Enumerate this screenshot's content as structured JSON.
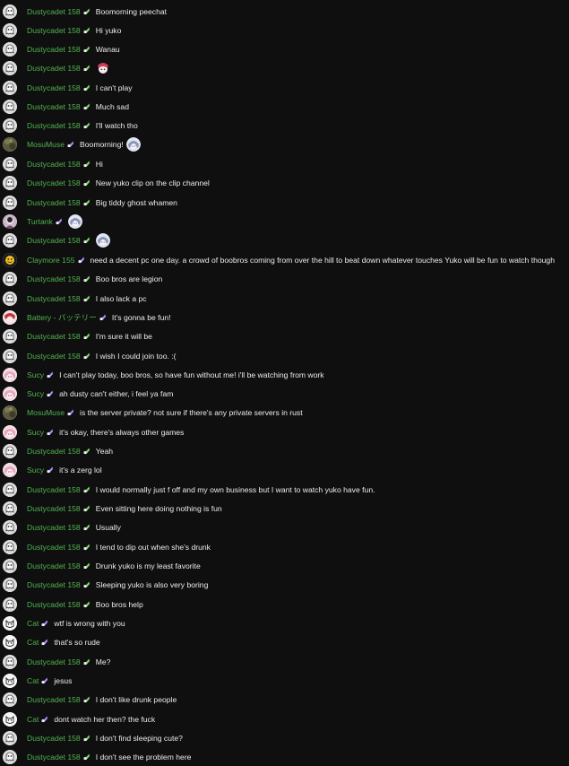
{
  "colors": {
    "username": "#51b34f",
    "text": "#ececec",
    "background": "#0f0f0f",
    "badge_green": "#7bdc6a",
    "badge_purple": "#b48cff"
  },
  "messages": [
    {
      "author": "Dustycadet 158",
      "text": "Boomorning peechat",
      "avatar": "ghost",
      "badge": "green"
    },
    {
      "author": "Dustycadet 158",
      "text": "Hi yuko",
      "avatar": "ghost",
      "badge": "green"
    },
    {
      "author": "Dustycadet 158",
      "text": "Wanau",
      "avatar": "ghost",
      "badge": "green"
    },
    {
      "author": "Dustycadet 158",
      "text": "",
      "avatar": "ghost",
      "badge": "green",
      "emote": "emote-anime-girl-icon"
    },
    {
      "author": "Dustycadet 158",
      "text": "I can't play",
      "avatar": "ghost",
      "badge": "green"
    },
    {
      "author": "Dustycadet 158",
      "text": "Much sad",
      "avatar": "ghost",
      "badge": "green"
    },
    {
      "author": "Dustycadet 158",
      "text": "I'll watch tho",
      "avatar": "ghost",
      "badge": "green"
    },
    {
      "author": "MosuMuse",
      "text": "Boomorning!",
      "avatar": "camo",
      "badge": "purple",
      "emote": "emote-yuko-icon"
    },
    {
      "author": "Dustycadet 158",
      "text": "Hi",
      "avatar": "ghost",
      "badge": "green"
    },
    {
      "author": "Dustycadet 158",
      "text": "New yuko clip on the clip channel",
      "avatar": "ghost",
      "badge": "green"
    },
    {
      "author": "Dustycadet 158",
      "text": "Big tiddy ghost whamen",
      "avatar": "ghost",
      "badge": "green"
    },
    {
      "author": "Turtank",
      "text": "",
      "avatar": "turtank",
      "badge": "purple",
      "emote": "emote-yuko-icon"
    },
    {
      "author": "Dustycadet 158",
      "text": "",
      "avatar": "ghost",
      "badge": "green",
      "emote": "emote-yuko-icon"
    },
    {
      "author": "Claymore 155",
      "text": "need a decent pc one day. a crowd of boobros coming from over the hill to beat down whatever touches Yuko will be fun to watch though",
      "avatar": "claymore",
      "badge": "purple"
    },
    {
      "author": "Dustycadet 158",
      "text": "Boo bros are legion",
      "avatar": "ghost",
      "badge": "green"
    },
    {
      "author": "Dustycadet 158",
      "text": "I also lack a pc",
      "avatar": "ghost",
      "badge": "green"
    },
    {
      "author": "Battery - バッテリー",
      "text": "It's gonna be fun!",
      "avatar": "battery",
      "badge": "purple"
    },
    {
      "author": "Dustycadet 158",
      "text": "I'm sure it will be",
      "avatar": "ghost",
      "badge": "green"
    },
    {
      "author": "Dustycadet 158",
      "text": "I wish I could join too. :(",
      "avatar": "ghost",
      "badge": "green"
    },
    {
      "author": "Sucy",
      "text": "I can't play today, boo bros, so have fun without me! i'll be watching from work",
      "avatar": "sucy",
      "badge": "purple"
    },
    {
      "author": "Sucy",
      "text": "ah dusty can't either, i feel ya fam",
      "avatar": "sucy",
      "badge": "purple"
    },
    {
      "author": "MosuMuse",
      "text": "is the server private? not sure if there's any private servers in rust",
      "avatar": "camo",
      "badge": "purple"
    },
    {
      "author": "Sucy",
      "text": "it's okay, there's always other games",
      "avatar": "sucy",
      "badge": "purple"
    },
    {
      "author": "Dustycadet 158",
      "text": "Yeah",
      "avatar": "ghost",
      "badge": "green"
    },
    {
      "author": "Sucy",
      "text": "it's a zerg lol",
      "avatar": "sucy",
      "badge": "purple"
    },
    {
      "author": "Dustycadet 158",
      "text": "I would normally just f off and my own business but I want to watch yuko have fun.",
      "avatar": "ghost",
      "badge": "green"
    },
    {
      "author": "Dustycadet 158",
      "text": "Even sitting here doing nothing is fun",
      "avatar": "ghost",
      "badge": "green"
    },
    {
      "author": "Dustycadet 158",
      "text": "Usually",
      "avatar": "ghost",
      "badge": "green"
    },
    {
      "author": "Dustycadet 158",
      "text": "I tend to dip out when she's drunk",
      "avatar": "ghost",
      "badge": "green"
    },
    {
      "author": "Dustycadet 158",
      "text": "Drunk yuko is my least favorite",
      "avatar": "ghost",
      "badge": "green"
    },
    {
      "author": "Dustycadet 158",
      "text": "Sleeping yuko is also very boring",
      "avatar": "ghost",
      "badge": "green"
    },
    {
      "author": "Dustycadet 158",
      "text": "Boo bros help",
      "avatar": "ghost",
      "badge": "green"
    },
    {
      "author": "Cat",
      "text": "wtf is wrong with you",
      "avatar": "cat",
      "badge": "purple"
    },
    {
      "author": "Cat",
      "text": "that's so rude",
      "avatar": "cat",
      "badge": "purple"
    },
    {
      "author": "Dustycadet 158",
      "text": "Me?",
      "avatar": "ghost",
      "badge": "green"
    },
    {
      "author": "Cat",
      "text": "jesus",
      "avatar": "cat",
      "badge": "purple"
    },
    {
      "author": "Dustycadet 158",
      "text": "I don't like drunk people",
      "avatar": "ghost",
      "badge": "green"
    },
    {
      "author": "Cat",
      "text": "dont watch her then? the fuck",
      "avatar": "cat",
      "badge": "purple"
    },
    {
      "author": "Dustycadet 158",
      "text": "I don't find sleeping cute?",
      "avatar": "ghost",
      "badge": "green"
    },
    {
      "author": "Dustycadet 158",
      "text": "I don't see the problem here",
      "avatar": "ghost",
      "badge": "green"
    }
  ]
}
